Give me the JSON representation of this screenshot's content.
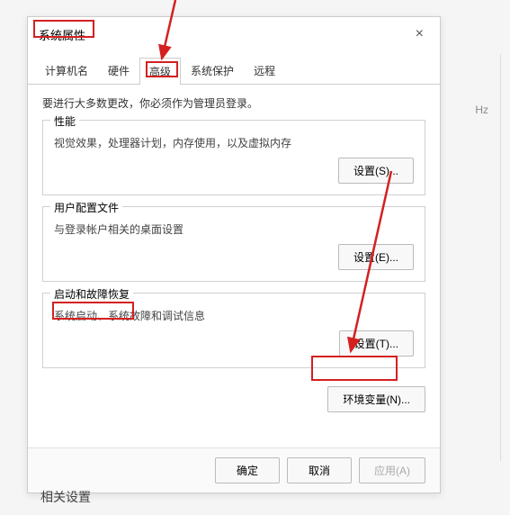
{
  "dialog": {
    "title": "系统属性",
    "close": "×"
  },
  "tabs": {
    "t0": "计算机名",
    "t1": "硬件",
    "t2": "高级",
    "t3": "系统保护",
    "t4": "远程"
  },
  "instruct": "要进行大多数更改，你必须作为管理员登录。",
  "groups": {
    "perf": {
      "title": "性能",
      "desc": "视觉效果，处理器计划，内存使用，以及虚拟内存",
      "btn": "设置(S)..."
    },
    "profile": {
      "title": "用户配置文件",
      "desc": "与登录帐户相关的桌面设置",
      "btn": "设置(E)..."
    },
    "startup": {
      "title": "启动和故障恢复",
      "desc": "系统启动、系统故障和调试信息",
      "btn": "设置(T)..."
    }
  },
  "env_btn": "环境变量(N)...",
  "footer": {
    "ok": "确定",
    "cancel": "取消",
    "apply": "应用(A)"
  },
  "side": {
    "related": "相关设置",
    "hz": "Hz"
  }
}
